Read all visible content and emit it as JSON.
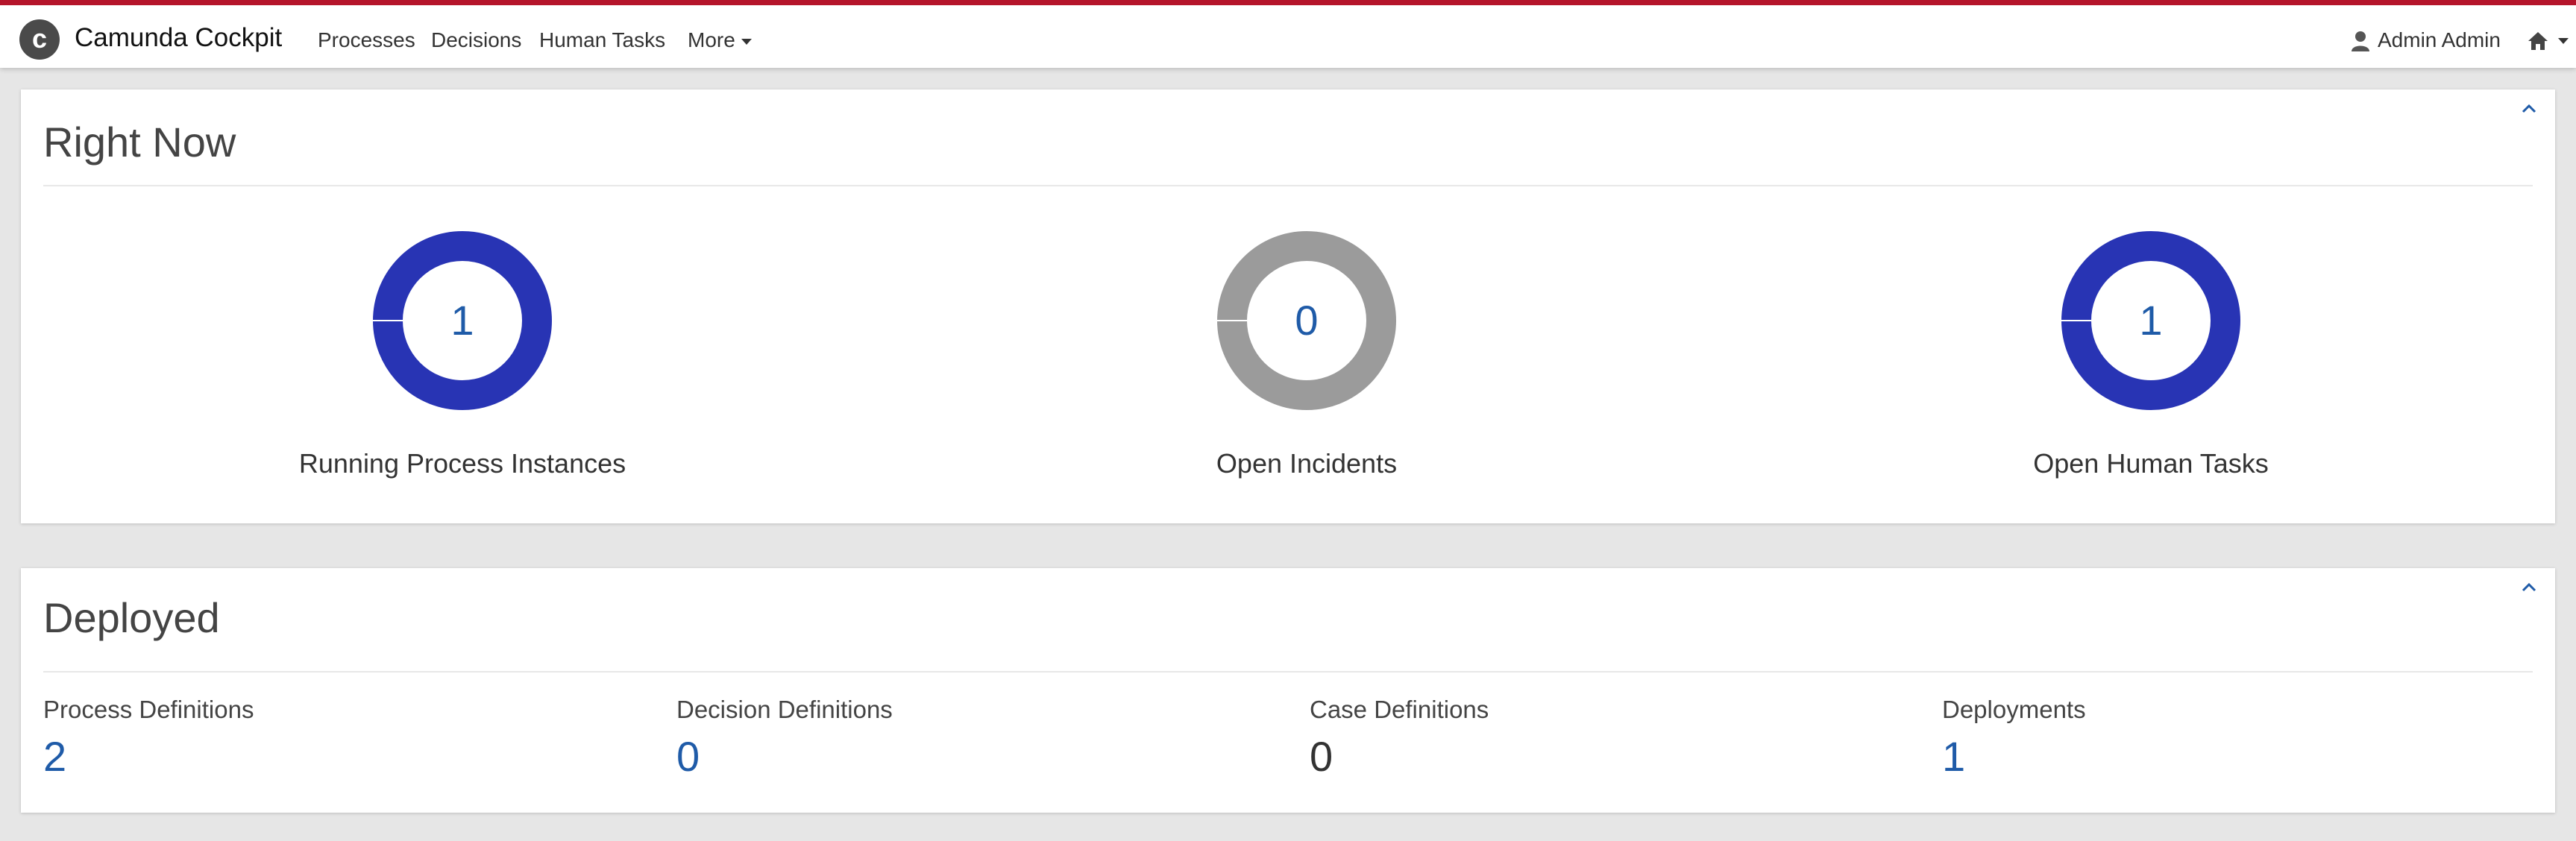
{
  "header": {
    "brand": "Camunda Cockpit",
    "nav": [
      {
        "label": "Processes"
      },
      {
        "label": "Decisions"
      },
      {
        "label": "Human Tasks"
      },
      {
        "label": "More"
      }
    ],
    "user": "Admin Admin",
    "icons": {
      "user": "user-icon",
      "home": "home-icon",
      "logo": "camunda-logo-icon"
    },
    "accent_color": "#b5152b"
  },
  "right_now": {
    "title": "Right Now",
    "stats": [
      {
        "value": "1",
        "label": "Running Process Instances",
        "color": "#2834b4"
      },
      {
        "value": "0",
        "label": "Open Incidents",
        "color": "#9b9b9b"
      },
      {
        "value": "1",
        "label": "Open Human Tasks",
        "color": "#2834b4"
      }
    ]
  },
  "deployed": {
    "title": "Deployed",
    "items": [
      {
        "label": "Process Definitions",
        "value": "2"
      },
      {
        "label": "Decision Definitions",
        "value": "0"
      },
      {
        "label": "Case Definitions",
        "value": "0"
      },
      {
        "label": "Deployments",
        "value": "1"
      }
    ]
  },
  "colors": {
    "link": "#1f5ba8",
    "donut_active": "#2834b4",
    "donut_empty": "#9b9b9b"
  }
}
